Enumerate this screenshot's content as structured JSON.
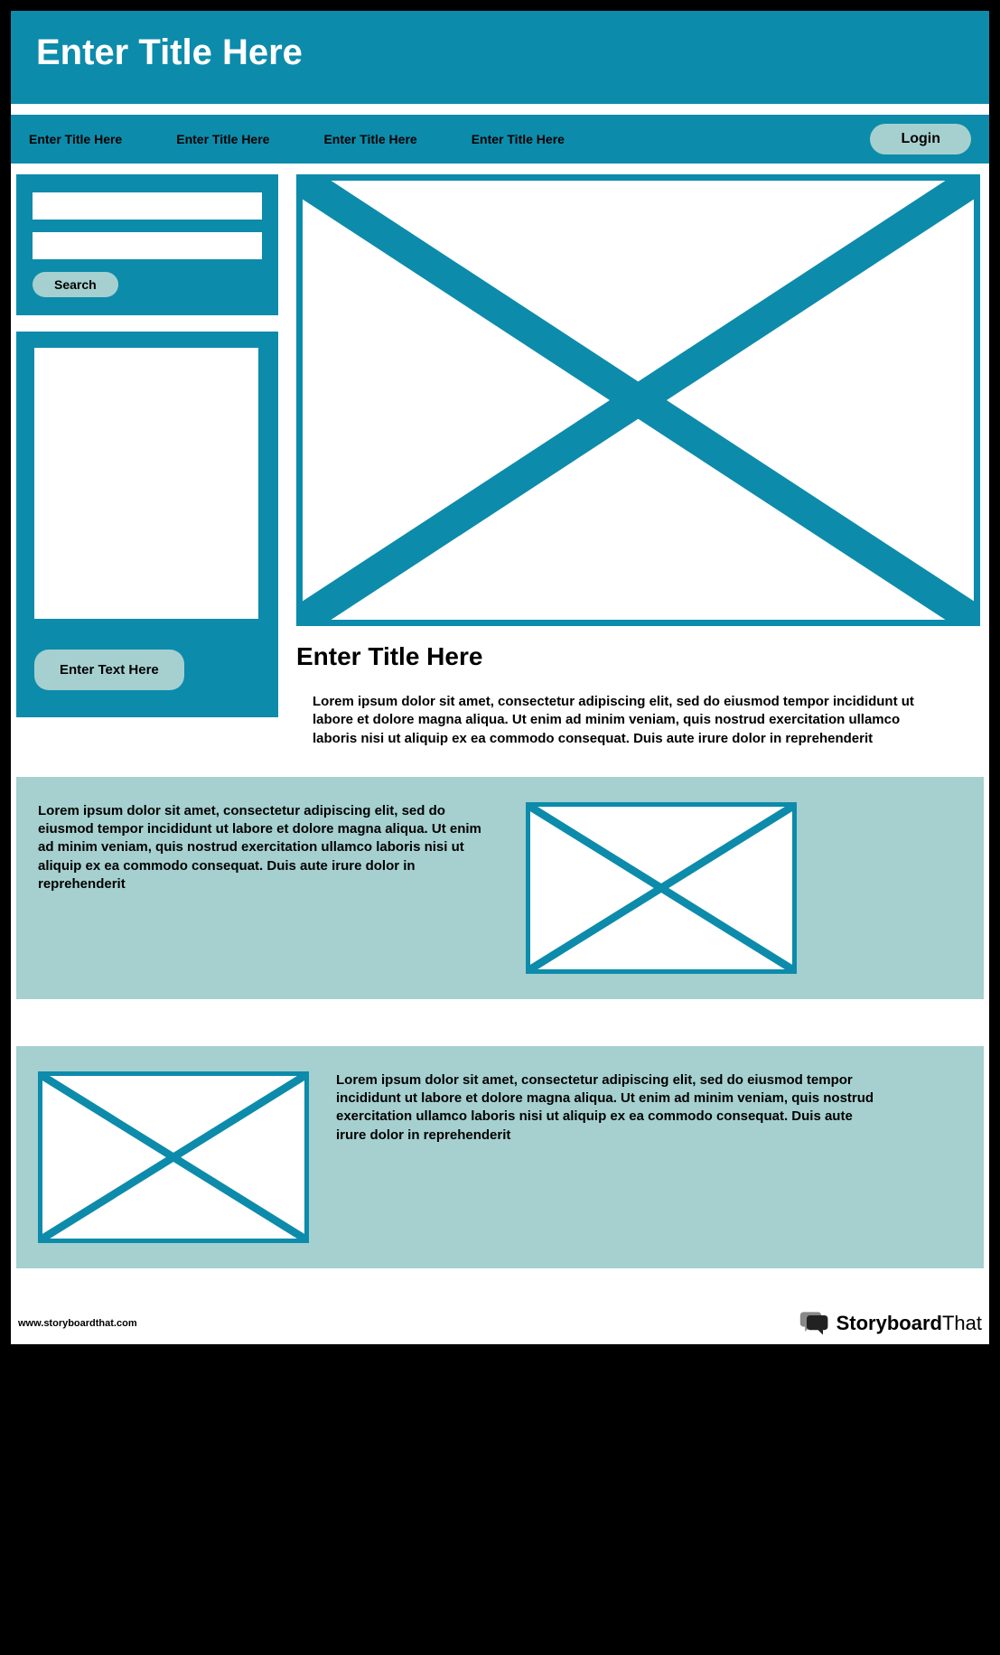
{
  "header": {
    "title": "Enter Title Here"
  },
  "nav": {
    "items": [
      {
        "label": "Enter Title Here"
      },
      {
        "label": "Enter Title Here"
      },
      {
        "label": "Enter Title Here"
      },
      {
        "label": "Enter Title Here"
      }
    ],
    "login_label": "Login"
  },
  "search": {
    "button_label": "Search"
  },
  "side_panel": {
    "button_label": "Enter Text Here"
  },
  "main": {
    "title": "Enter Title Here",
    "body": "Lorem ipsum dolor sit amet, consectetur adipiscing elit, sed do eiusmod tempor incididunt ut labore et dolore magna aliqua. Ut enim ad minim veniam, quis nostrud exercitation ullamco laboris nisi ut aliquip ex ea commodo consequat. Duis aute irure dolor in reprehenderit"
  },
  "band1": {
    "text": "Lorem ipsum dolor sit amet, consectetur adipiscing elit, sed do eiusmod tempor incididunt ut labore et dolore magna aliqua. Ut enim ad minim veniam, quis nostrud exercitation ullamco laboris nisi ut aliquip ex ea commodo consequat. Duis aute irure dolor in reprehenderit"
  },
  "band2": {
    "text": "Lorem ipsum dolor sit amet, consectetur adipiscing elit, sed do eiusmod tempor incididunt ut labore et dolore magna aliqua. Ut enim ad minim veniam, quis nostrud exercitation ullamco laboris nisi ut aliquip ex ea commodo consequat. Duis aute irure dolor in reprehenderit"
  },
  "footer": {
    "url": "www.storyboardthat.com",
    "brand_bold": "Storyboard",
    "brand_light": "That"
  }
}
